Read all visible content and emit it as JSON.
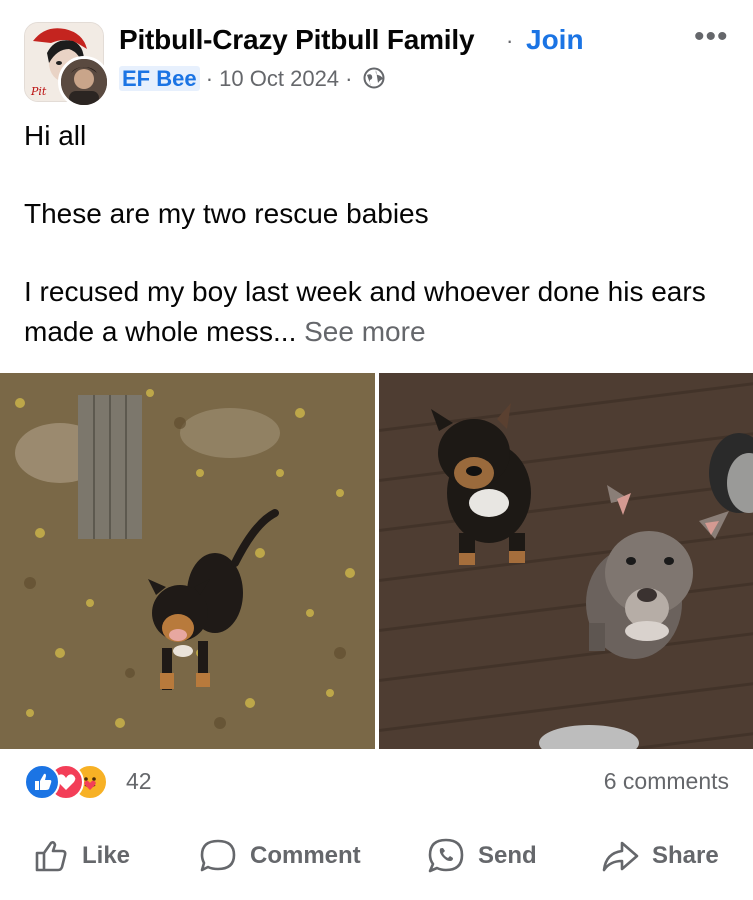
{
  "post": {
    "group_name": "Pitbull-Crazy Pitbull Family",
    "separator": "·",
    "join_label": "Join",
    "author": "EF Bee",
    "date": "10 Oct 2024",
    "meta_separator": "·",
    "privacy_icon": "globe-icon",
    "more_label": "•••",
    "paragraphs": [
      "Hi all",
      "These are my two rescue babies",
      "I recused my boy last week and whoever done his ears made a whole mess..."
    ],
    "see_more_label": "See more"
  },
  "photos": [
    {
      "description_icon": "dog-on-leaves-photo"
    },
    {
      "description_icon": "two-dogs-on-floor-photo"
    }
  ],
  "engagement": {
    "reaction_icons": [
      "like-icon",
      "love-icon",
      "care-icon"
    ],
    "reaction_count": "42",
    "comments_label": "6 comments"
  },
  "actions": {
    "like": "Like",
    "comment": "Comment",
    "send": "Send",
    "share": "Share"
  },
  "colors": {
    "accent": "#1b74e4",
    "secondary_text": "#65676b",
    "love": "#f33e58",
    "care": "#f7b125"
  }
}
